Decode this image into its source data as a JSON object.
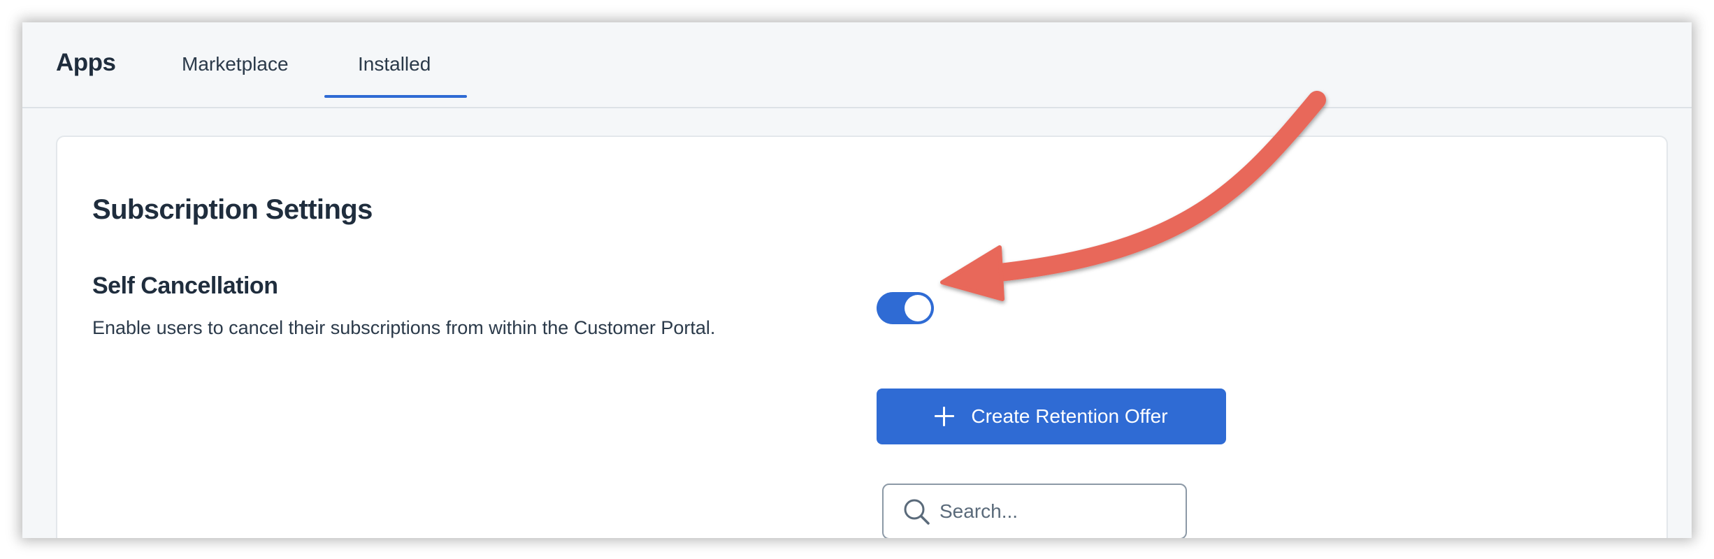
{
  "header": {
    "app_title": "Apps",
    "tabs": [
      {
        "label": "Marketplace",
        "active": false
      },
      {
        "label": "Installed",
        "active": true
      }
    ]
  },
  "settings": {
    "title": "Subscription Settings",
    "self_cancellation": {
      "title": "Self Cancellation",
      "description": "Enable users to cancel their subscriptions from within the Customer Portal.",
      "enabled": true
    },
    "create_button_label": "Create Retention Offer",
    "search": {
      "value": "",
      "placeholder": "Search..."
    }
  },
  "colors": {
    "accent": "#2f6bd4",
    "annotation_arrow": "#e8675a",
    "title_text": "#1f2d3d"
  },
  "icons": {
    "plus": "plus-icon",
    "search": "search-icon",
    "annotation": "curved-arrow-icon"
  }
}
